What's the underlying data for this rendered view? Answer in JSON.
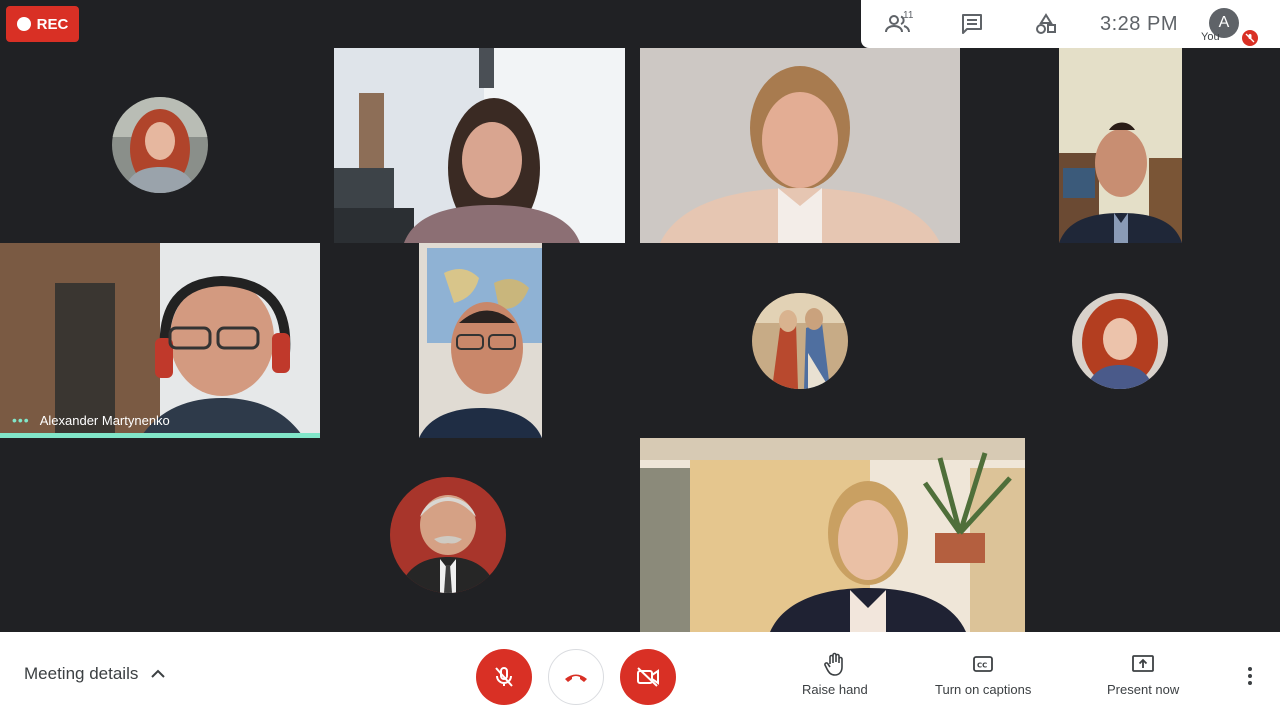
{
  "recording": {
    "label": "REC"
  },
  "topbar": {
    "participants_count": "11",
    "time": "3:28  PM",
    "self_initial": "A",
    "self_label": "You"
  },
  "tiles": [
    {
      "id": "p1",
      "type": "avatar"
    },
    {
      "id": "p2",
      "type": "video"
    },
    {
      "id": "p3",
      "type": "video"
    },
    {
      "id": "p4",
      "type": "video"
    },
    {
      "id": "p5",
      "type": "video",
      "name": "Alexander Martynenko",
      "speaking": true
    },
    {
      "id": "p6",
      "type": "video"
    },
    {
      "id": "p7",
      "type": "avatar"
    },
    {
      "id": "p8",
      "type": "avatar"
    },
    {
      "id": "p9",
      "type": "avatar"
    },
    {
      "id": "p10",
      "type": "video"
    }
  ],
  "bottombar": {
    "meeting_details": "Meeting details",
    "raise_hand": "Raise hand",
    "captions": "Turn on captions",
    "present": "Present now"
  },
  "colors": {
    "background": "#202124",
    "accent_red": "#d93025",
    "speaking": "#81e6c9"
  }
}
